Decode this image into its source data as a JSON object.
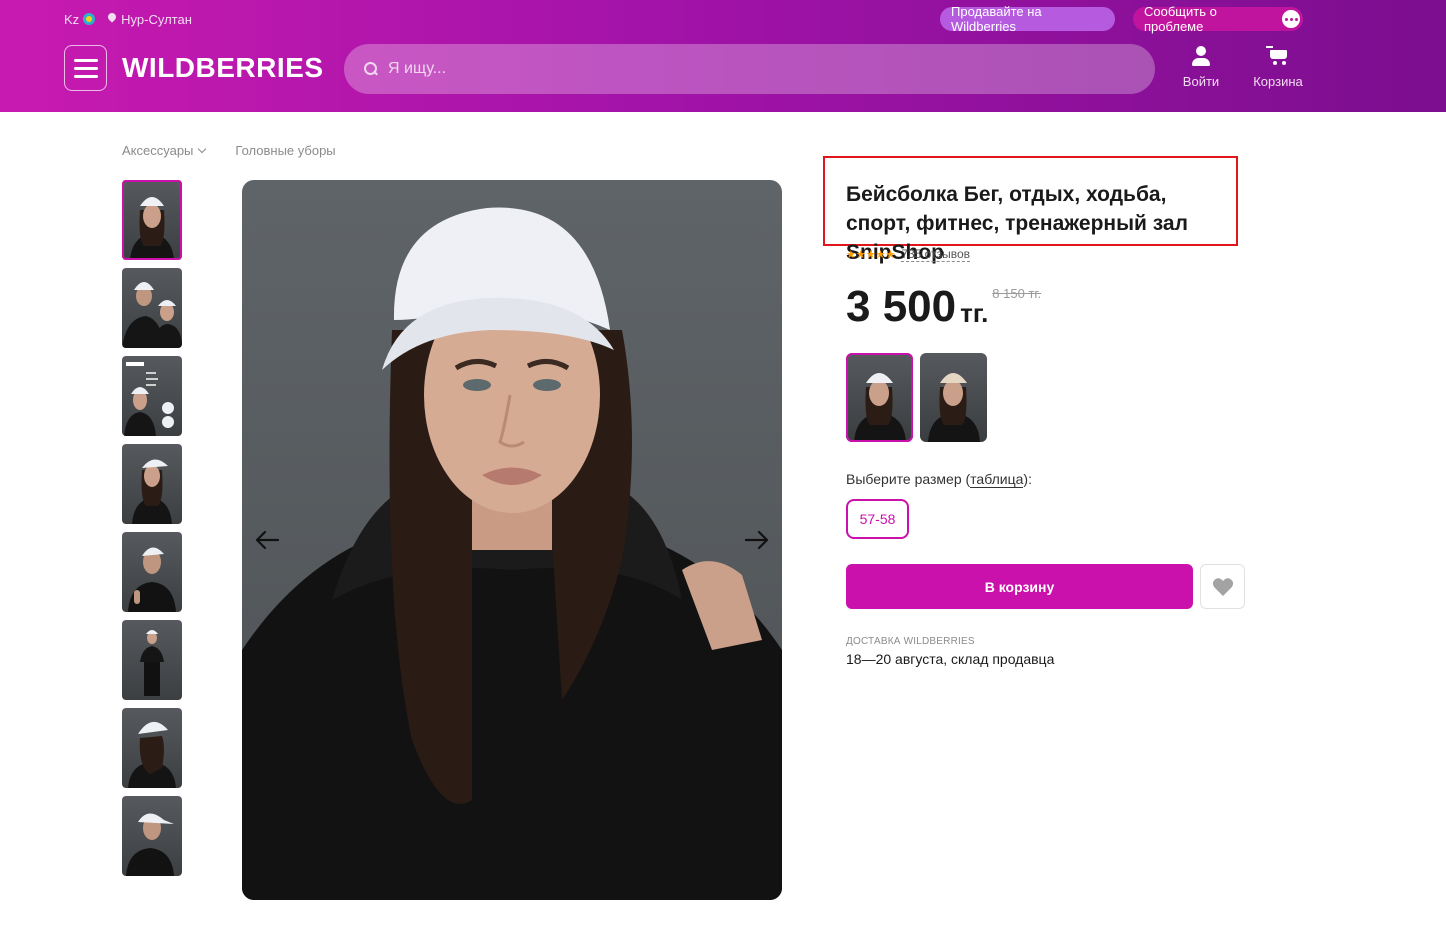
{
  "header": {
    "country": "Kz",
    "city": "Нур-Султан",
    "sell_label": "Продавайте на Wildberries",
    "report_label": "Сообщить о проблеме",
    "logo": "WILDBERRIES",
    "search_placeholder": "Я ищу...",
    "login_label": "Войти",
    "cart_label": "Корзина"
  },
  "breadcrumbs": [
    "Аксессуары",
    "Головные уборы"
  ],
  "gallery": {
    "thumbnail_count": 8,
    "active_index": 0
  },
  "product": {
    "title": "Бейсболка Бег, отдых, ходьба, спорт, фитнес, тренажерный зал  SnipShop",
    "stars": "★★★★★",
    "reviews": "735 отзывов",
    "price": "3 500",
    "currency": "тг.",
    "old_price": "8 150 тг.",
    "size_prompt_before": "Выберите размер (",
    "size_table_link": "таблица",
    "size_prompt_after": "):",
    "sizes": [
      "57-58"
    ],
    "add_to_cart": "В корзину",
    "delivery_caption": "Доставка Wildberries",
    "delivery_value": "18—20 августа, склад продавца"
  },
  "colors": {
    "accent": "#cb11ab",
    "highlight_border": "#e0161a"
  }
}
